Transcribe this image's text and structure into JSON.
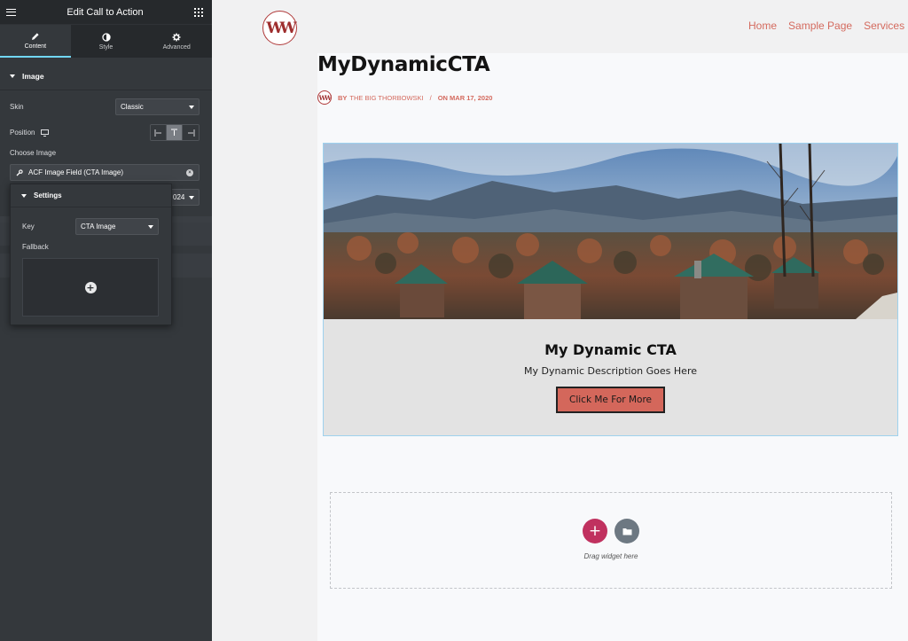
{
  "panel": {
    "title": "Edit Call to Action",
    "tabs": [
      {
        "label": "Content",
        "icon": "pencil-icon",
        "active": true
      },
      {
        "label": "Style",
        "icon": "half-circle-icon",
        "active": false
      },
      {
        "label": "Advanced",
        "icon": "gear-icon",
        "active": false
      }
    ],
    "section_title": "Image",
    "skin_label": "Skin",
    "skin_value": "Classic",
    "position_label": "Position",
    "choose_image_label": "Choose Image",
    "dynamic_field_value": "ACF Image Field (CTA Image)",
    "size_value_partial": "024",
    "settings": {
      "title": "Settings",
      "key_label": "Key",
      "key_value": "CTA Image",
      "fallback_label": "Fallback"
    },
    "accent_color": "#71d7f7"
  },
  "site": {
    "logo_text": "W",
    "nav": [
      "Home",
      "Sample Page",
      "Services"
    ],
    "post_title": "MyDynamicCTA",
    "meta": {
      "by": "BY",
      "author": "THE BIG THORBOWSKI",
      "separator": "/",
      "date": "ON MAR 17, 2020"
    },
    "cta": {
      "title": "My Dynamic CTA",
      "description": "My Dynamic Description Goes Here",
      "button_label": "Click Me For More",
      "button_color": "#d4675b"
    },
    "dropzone_text": "Drag widget here",
    "brand_color": "#d46a5e"
  }
}
